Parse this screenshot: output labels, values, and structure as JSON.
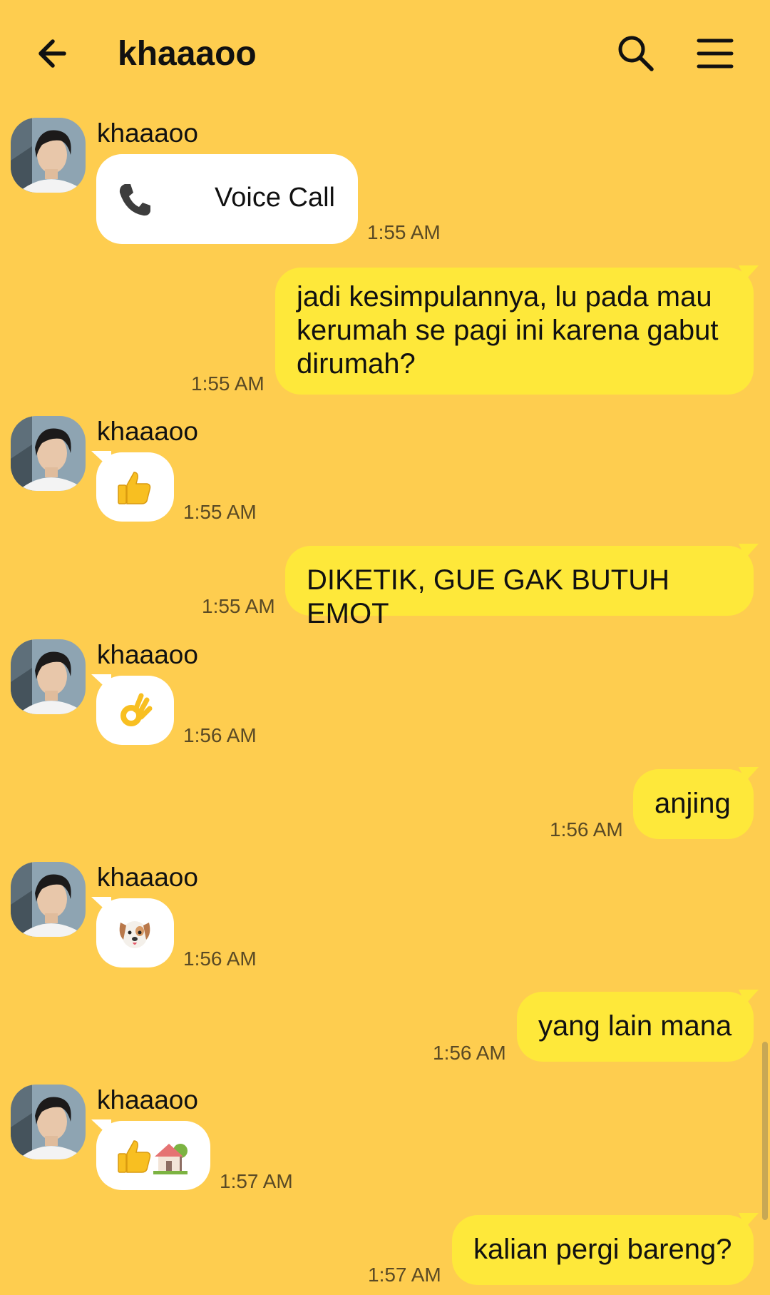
{
  "header": {
    "title": "khaaaoo"
  },
  "messages": [
    {
      "sender": "khaaaoo",
      "call_label": "Voice Call",
      "time": "1:55 AM"
    },
    {
      "text": "jadi kesimpulannya, lu pada mau kerumah se pagi ini karena gabut dirumah?",
      "time": "1:55 AM"
    },
    {
      "sender": "khaaaoo",
      "emoji": "thumbs-up",
      "time": "1:55 AM"
    },
    {
      "text": "DIKETIK, GUE GAK BUTUH EMOT",
      "time": "1:55 AM"
    },
    {
      "sender": "khaaaoo",
      "emoji": "ok-hand",
      "time": "1:56 AM"
    },
    {
      "text": "anjing",
      "time": "1:56 AM"
    },
    {
      "sender": "khaaaoo",
      "emoji": "dog-face",
      "time": "1:56 AM"
    },
    {
      "text": "yang lain mana",
      "time": "1:56 AM"
    },
    {
      "sender": "khaaaoo",
      "emoji": "thumbs-up + house",
      "time": "1:57 AM"
    },
    {
      "text": "kalian pergi bareng?",
      "time": "1:57 AM"
    }
  ],
  "colors": {
    "background": "#fecd4f",
    "outgoing_bubble": "#fee83a",
    "incoming_bubble": "#ffffff"
  }
}
